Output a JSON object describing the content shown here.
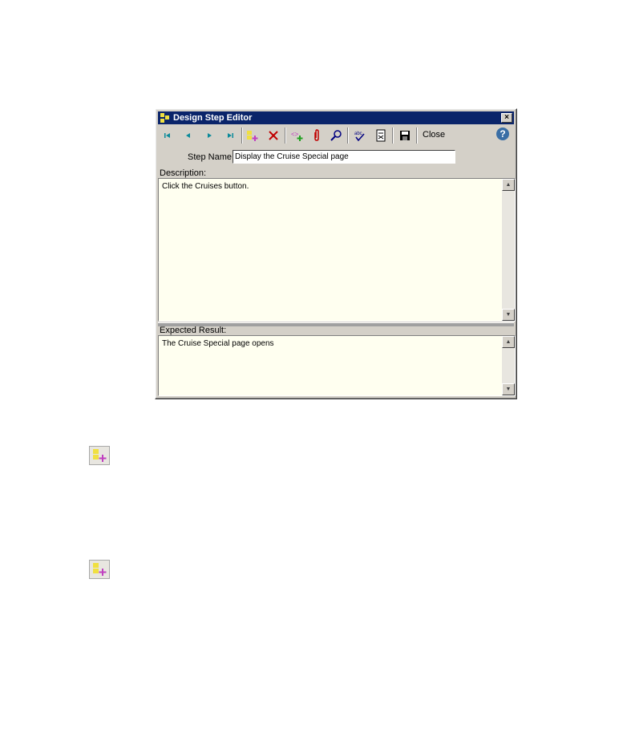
{
  "window": {
    "title": "Design Step Editor",
    "close_glyph": "×"
  },
  "toolbar": {
    "buttons": [
      {
        "name": "first-record-icon",
        "glyph": "|◄",
        "color": "#0a8a9a"
      },
      {
        "name": "previous-record-icon",
        "glyph": "◄",
        "color": "#0a8a9a"
      },
      {
        "name": "next-record-icon",
        "glyph": "►",
        "color": "#0a8a9a"
      },
      {
        "name": "last-record-icon",
        "glyph": "►|",
        "color": "#0a8a9a"
      },
      {
        "name": "new-step-icon",
        "glyph": "new-step",
        "color": "#e0d020"
      },
      {
        "name": "delete-step-icon",
        "glyph": "✕",
        "color": "#c00000"
      },
      {
        "name": "insert-parameter-icon",
        "glyph": "param",
        "color": "#c040c0"
      },
      {
        "name": "attachment-icon",
        "glyph": "attach",
        "color": "#c00000"
      },
      {
        "name": "zoom-icon",
        "glyph": "zoom",
        "color": "#000080"
      },
      {
        "name": "spell-check-icon",
        "glyph": "abc✓",
        "color": "#000080"
      },
      {
        "name": "thesaurus-icon",
        "glyph": "doc",
        "color": "#000000"
      },
      {
        "name": "save-icon",
        "glyph": "disk",
        "color": "#000000"
      }
    ],
    "close_label": "Close",
    "help_glyph": "?"
  },
  "form": {
    "step_name_label": "Step Name:",
    "step_name_value": "Display the Cruise Special page",
    "description_label": "Description:",
    "description_value": "Click the Cruises button.",
    "expected_label": "Expected Result:",
    "expected_value": "The Cruise Special page opens"
  }
}
